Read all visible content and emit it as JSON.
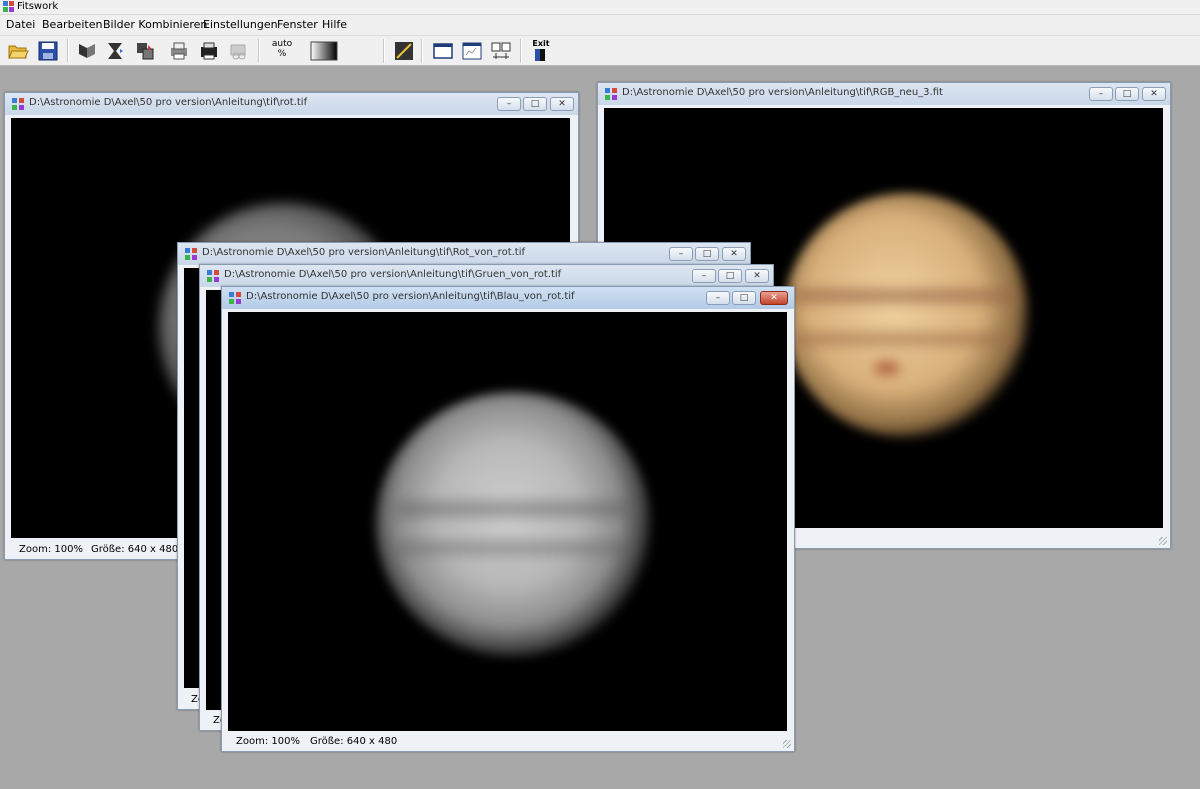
{
  "app": {
    "title": "Fitswork"
  },
  "menu": [
    "Datei",
    "Bearbeiten",
    "Bilder Kombinieren",
    "Einstellungen",
    "Fenster",
    "Hilfe"
  ],
  "toolbar": {
    "auto_label": "auto",
    "auto_sub": "%",
    "exit_label": "Exit",
    "icons": [
      "open-folder-icon",
      "save-icon",
      "flip-icon",
      "hourglass-icon",
      "layers-icon",
      "print-icon",
      "printer-icon",
      "scan-icon",
      "gradient-icon",
      "histogram-icon",
      "window-icon",
      "chart-window-icon",
      "compare-icon",
      "exit-icon"
    ]
  },
  "windows": [
    {
      "id": "rot",
      "title": "D:\\Astronomie D\\Axel\\50 pro version\\Anleitung\\tif\\rot.tif",
      "zoom": "Zoom: 100%",
      "size": "Größe: 640 x 480"
    },
    {
      "id": "rgb",
      "title": "D:\\Astronomie D\\Axel\\50 pro version\\Anleitung\\tif\\RGB_neu_3.fit",
      "zoom": "",
      "size": ""
    },
    {
      "id": "rot_von_rot",
      "title": "D:\\Astronomie D\\Axel\\50 pro version\\Anleitung\\tif\\Rot_von_rot.tif",
      "zoom": "Zo",
      "size": ""
    },
    {
      "id": "gruen_von_rot",
      "title": "D:\\Astronomie D\\Axel\\50 pro version\\Anleitung\\tif\\Gruen_von_rot.tif",
      "zoom": "Zo",
      "size": ""
    },
    {
      "id": "blau_von_rot",
      "title": "D:\\Astronomie D\\Axel\\50 pro version\\Anleitung\\tif\\Blau_von_rot.tif",
      "zoom": "Zoom: 100%",
      "size": "Größe: 640 x 480"
    }
  ],
  "colors": {
    "planet_gray": "#8e8e8e",
    "planet_rgb": "#d8b07a",
    "band": "#9a6a48",
    "background": "#a8a8a8"
  }
}
